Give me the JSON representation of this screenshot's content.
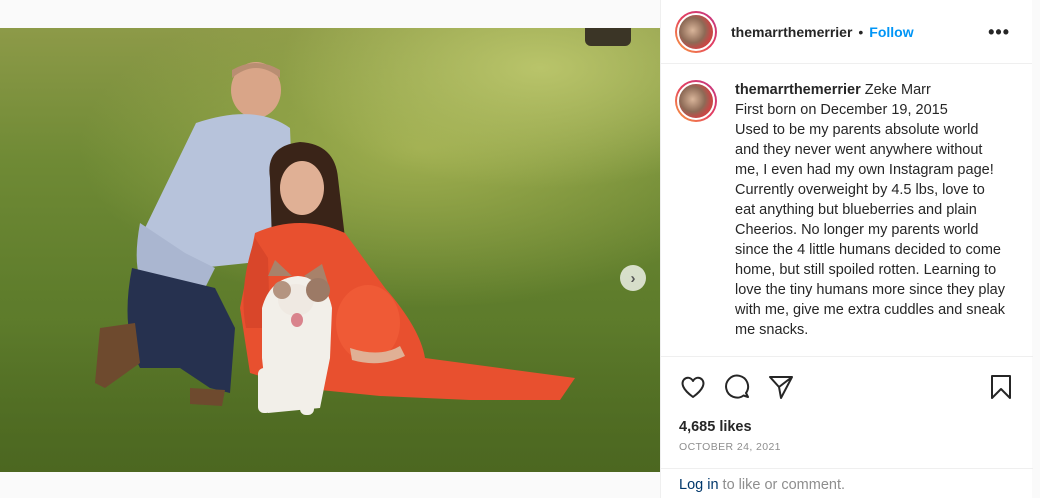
{
  "post": {
    "username": "themarrthemerrier",
    "follow_label": "Follow",
    "bullet": "•",
    "more_label": "•••"
  },
  "caption": {
    "username": "themarrthemerrier",
    "text": "Zeke Marr\nFirst born on December 19, 2015\nUsed to be my parents absolute world and they never went anywhere without me, I even had my own Instagram page! Currently overweight by 4.5 lbs, love to eat anything but blueberries and plain Cheerios. No longer my parents world since the 4 little humans decided to come home, but still spoiled rotten. Learning to love the tiny humans more since they play with me, give me extra cuddles and sneak me snacks."
  },
  "stats": {
    "likes": "4,685 likes",
    "date": "OCTOBER 24, 2021"
  },
  "footer": {
    "login_label": "Log in",
    "rest": " to like or comment."
  },
  "carousel": {
    "total": 9,
    "active_index": 0
  },
  "icons": {
    "like": "heart-icon",
    "comment": "comment-icon",
    "share": "share-icon",
    "save": "bookmark-icon",
    "next": "chevron-right-icon"
  }
}
